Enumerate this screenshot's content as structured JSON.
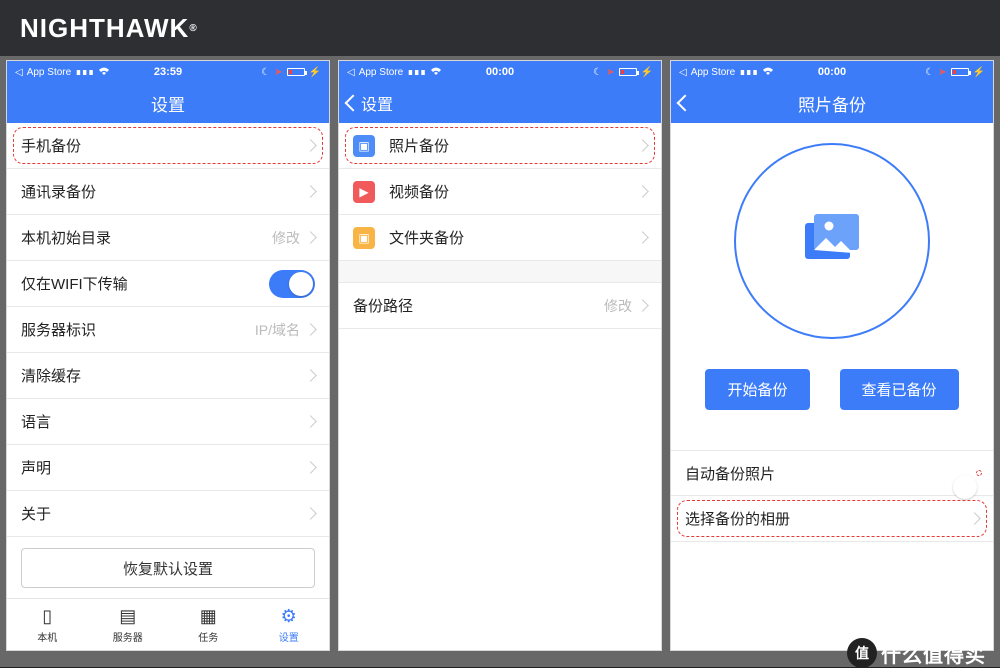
{
  "brand": "NIGHTHAWK",
  "status": {
    "app_store": "App Store"
  },
  "screen1": {
    "time": "23:59",
    "title": "设置",
    "rows": [
      {
        "label": "手机备份",
        "highlight": true
      },
      {
        "label": "通讯录备份"
      },
      {
        "label": "本机初始目录",
        "val": "修改"
      },
      {
        "label": "仅在WIFI下传输",
        "toggle": true
      },
      {
        "label": "服务器标识",
        "val": "IP/域名"
      },
      {
        "label": "清除缓存"
      },
      {
        "label": "语言"
      },
      {
        "label": "声明"
      },
      {
        "label": "关于"
      }
    ],
    "restore": "恢复默认设置",
    "tabs": [
      {
        "label": "本机",
        "icon": "▢"
      },
      {
        "label": "服务器",
        "icon": "▤"
      },
      {
        "label": "任务",
        "icon": "▦"
      },
      {
        "label": "设置",
        "icon": "⚙",
        "active": true
      }
    ]
  },
  "screen2": {
    "time": "00:00",
    "back": "设置",
    "items": [
      {
        "label": "照片备份",
        "color": "blue",
        "glyph": "◫",
        "highlight": true
      },
      {
        "label": "视频备份",
        "color": "red",
        "glyph": "▶"
      },
      {
        "label": "文件夹备份",
        "color": "orange",
        "glyph": "▣"
      }
    ],
    "path_row": {
      "label": "备份路径",
      "val": "修改"
    }
  },
  "screen3": {
    "time": "00:00",
    "title": "照片备份",
    "buttons": {
      "start": "开始备份",
      "view": "查看已备份"
    },
    "auto_row": "自动备份照片",
    "select_row": "选择备份的相册"
  },
  "watermark": "什么值得买"
}
